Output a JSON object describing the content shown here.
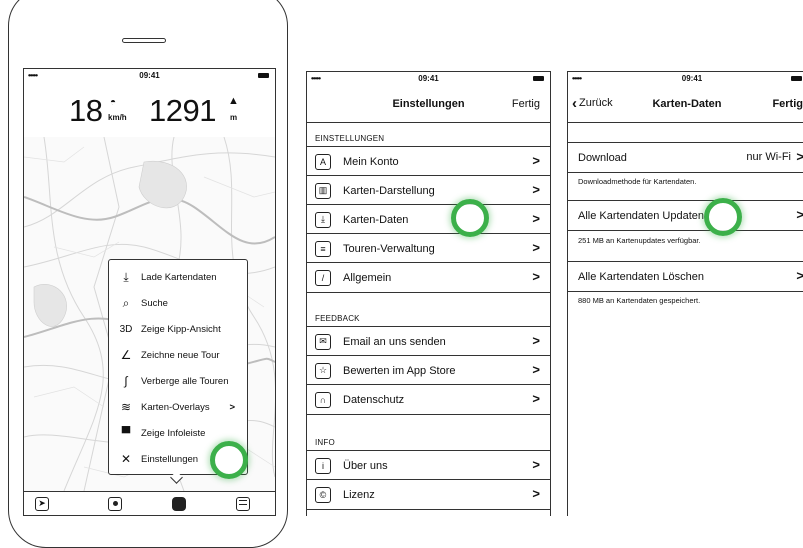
{
  "status": {
    "dots": "•••••",
    "time": "09:41"
  },
  "map_screen": {
    "speed_value": "18",
    "speed_unit": "km/h",
    "altitude_value": "1291",
    "altitude_unit": "m",
    "menu_items": [
      {
        "icon": "download-icon",
        "glyph": "⤓",
        "label": "Lade Kartendaten"
      },
      {
        "icon": "search-icon",
        "glyph": "⌕",
        "label": "Suche"
      },
      {
        "icon": "3d-icon",
        "glyph": "3D",
        "label": "Zeige Kipp-Ansicht"
      },
      {
        "icon": "draw-route-icon",
        "glyph": "∠",
        "label": "Zeichne neue Tour"
      },
      {
        "icon": "route-icon",
        "glyph": "∫",
        "label": "Verberge alle Touren"
      },
      {
        "icon": "layers-icon",
        "glyph": "≋",
        "label": "Karten-Overlays",
        "chevron": ">"
      },
      {
        "icon": "infobar-icon",
        "glyph": "▀",
        "label": "Zeige Infoleiste"
      },
      {
        "icon": "tools-icon",
        "glyph": "✕",
        "label": "Einstellungen"
      }
    ],
    "tabbar": [
      "navigate-icon",
      "record-icon",
      "menu-icon",
      "list-icon"
    ]
  },
  "settings_screen": {
    "title": "Einstellungen",
    "done": "Fertig",
    "sections": [
      {
        "header": "EINSTELLUNGEN",
        "rows": [
          {
            "icon": "account-icon",
            "glyph": "A",
            "label": "Mein Konto"
          },
          {
            "icon": "map-display-icon",
            "glyph": "▥",
            "label": "Karten-Darstellung"
          },
          {
            "icon": "download-icon",
            "glyph": "⤓",
            "label": "Karten-Daten"
          },
          {
            "icon": "tour-manager-icon",
            "glyph": "≡",
            "label": "Touren-Verwaltung"
          },
          {
            "icon": "wrench-icon",
            "glyph": "/",
            "label": "Allgemein"
          }
        ]
      },
      {
        "header": "FEEDBACK",
        "rows": [
          {
            "icon": "mail-icon",
            "glyph": "✉",
            "label": "Email an uns senden"
          },
          {
            "icon": "star-icon",
            "glyph": "☆",
            "label": "Bewerten im App Store"
          },
          {
            "icon": "lock-icon",
            "glyph": "∩",
            "label": "Datenschutz"
          }
        ]
      },
      {
        "header": "INFO",
        "rows": [
          {
            "icon": "info-icon",
            "glyph": "i",
            "label": "Über uns"
          },
          {
            "icon": "copyright-icon",
            "glyph": "©",
            "label": "Lizenz"
          }
        ]
      }
    ],
    "chevron": ">"
  },
  "map_data_screen": {
    "back": "Zurück",
    "title": "Karten-Daten",
    "done": "Fertig",
    "download_label": "Download",
    "download_value": "nur Wi-Fi",
    "download_note": "Downloadmethode für Kartendaten.",
    "update_label": "Alle Kartendaten Updaten",
    "update_note": "251 MB an Kartenupdates verfügbar.",
    "delete_label": "Alle Kartendaten Löschen",
    "delete_note": "880 MB an Kartendaten gespeichert.",
    "chevron": ">"
  },
  "accent_color": "#3cb04a"
}
